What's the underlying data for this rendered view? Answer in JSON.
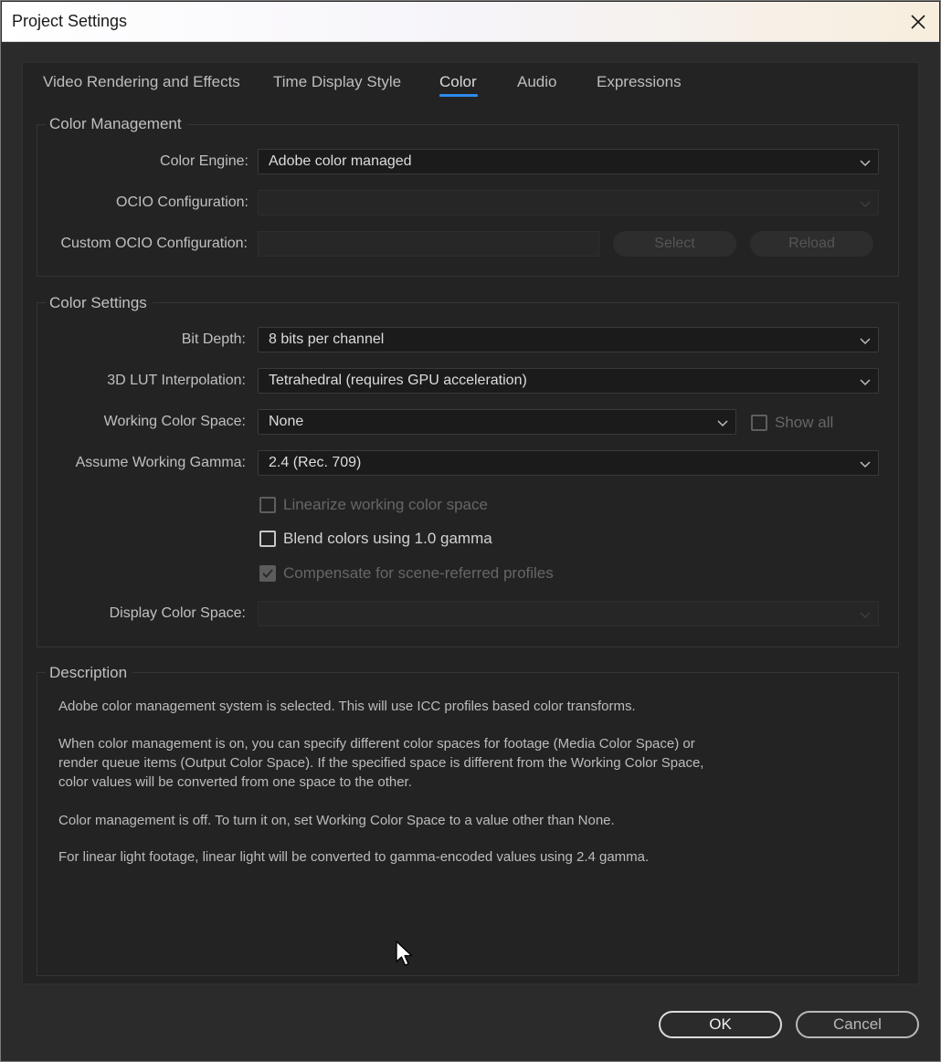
{
  "window": {
    "title": "Project Settings"
  },
  "tabs": [
    {
      "label": "Video Rendering and Effects"
    },
    {
      "label": "Time Display Style"
    },
    {
      "label": "Color",
      "active": true
    },
    {
      "label": "Audio"
    },
    {
      "label": "Expressions"
    }
  ],
  "color_management": {
    "title": "Color Management",
    "color_engine": {
      "label": "Color Engine:",
      "value": "Adobe color managed"
    },
    "ocio_configuration": {
      "label": "OCIO Configuration:",
      "value": ""
    },
    "custom_ocio": {
      "label": "Custom OCIO Configuration:",
      "value": "",
      "select_label": "Select",
      "reload_label": "Reload"
    }
  },
  "color_settings": {
    "title": "Color Settings",
    "bit_depth": {
      "label": "Bit Depth:",
      "value": "8 bits per channel"
    },
    "lut_interpolation": {
      "label": "3D LUT Interpolation:",
      "value": "Tetrahedral (requires GPU acceleration)"
    },
    "working_color_space": {
      "label": "Working Color Space:",
      "value": "None",
      "show_all_label": "Show all",
      "show_all_checked": false
    },
    "working_gamma": {
      "label": "Assume Working Gamma:",
      "value": "2.4 (Rec. 709)"
    },
    "linearize": {
      "label": "Linearize working color space",
      "checked": false,
      "enabled": false
    },
    "blend_gamma": {
      "label": "Blend colors using 1.0 gamma",
      "checked": false,
      "enabled": true
    },
    "compensate": {
      "label": "Compensate for scene-referred profiles",
      "checked": true,
      "enabled": false
    },
    "display_color_space": {
      "label": "Display Color Space:",
      "value": ""
    }
  },
  "description": {
    "title": "Description",
    "line1": "Adobe color management system is selected. This will use ICC profiles based color transforms.",
    "para2_line1": "When color management is on, you can specify different color spaces for footage (Media Color Space) or",
    "para2_line2": "render queue items (Output Color Space). If the specified space is different from the Working Color Space,",
    "para2_line3": "color values will be converted from one space to the other.",
    "line3": "Color management is off. To turn it on, set Working Color Space to a value other than None.",
    "line4": "For linear light footage, linear light will be converted to gamma-encoded values using 2.4 gamma."
  },
  "buttons": {
    "ok": "OK",
    "cancel": "Cancel"
  },
  "colors": {
    "accent": "#2d8ceb",
    "background": "#232323",
    "field": "#1b1b1b"
  }
}
